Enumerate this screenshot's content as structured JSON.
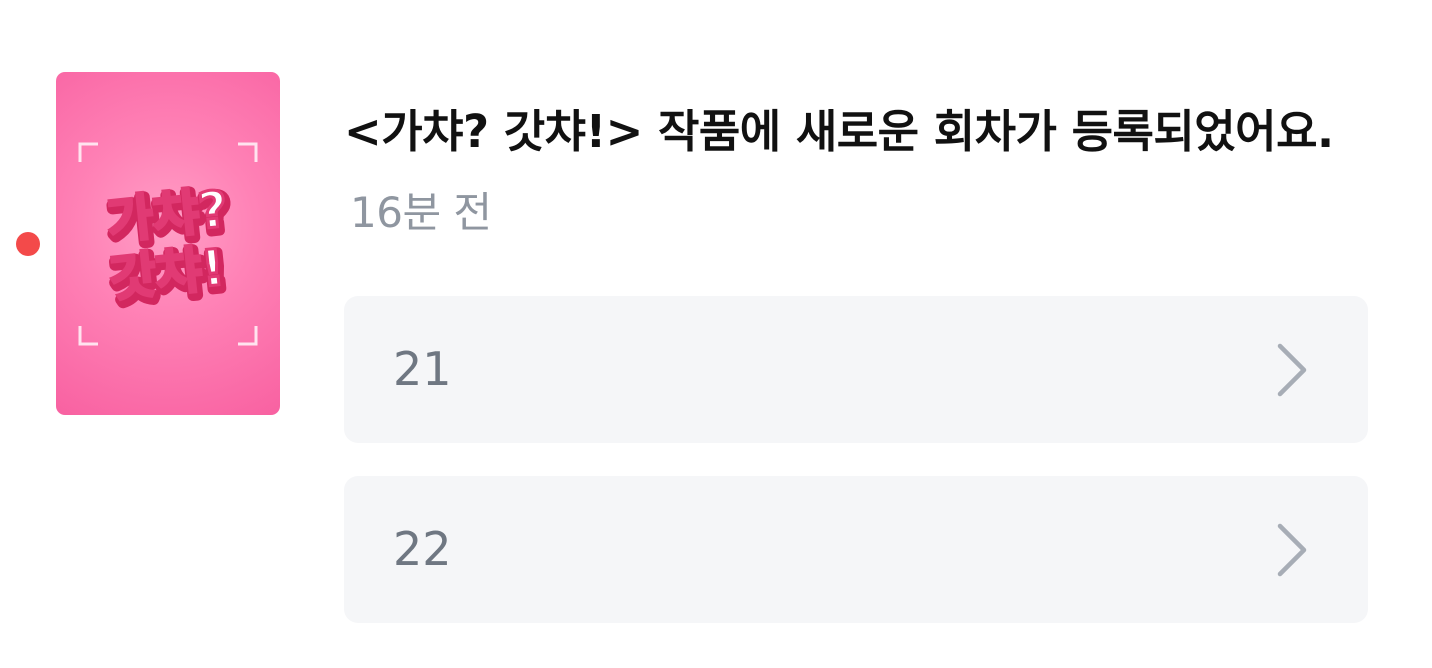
{
  "notification": {
    "unread_color": "#f34a4a",
    "thumbnail": {
      "art_text_line1": "가챠?",
      "art_text_line2": "갓챠!",
      "background_color": "#ff82b6"
    },
    "title": "<가챠? 갓챠!> 작품에 새로운 회차가 등록되었어요.",
    "time_ago": "16분 전",
    "episodes": [
      {
        "label": "21",
        "icon": "chevron-right-icon"
      },
      {
        "label": "22",
        "icon": "chevron-right-icon"
      }
    ]
  }
}
